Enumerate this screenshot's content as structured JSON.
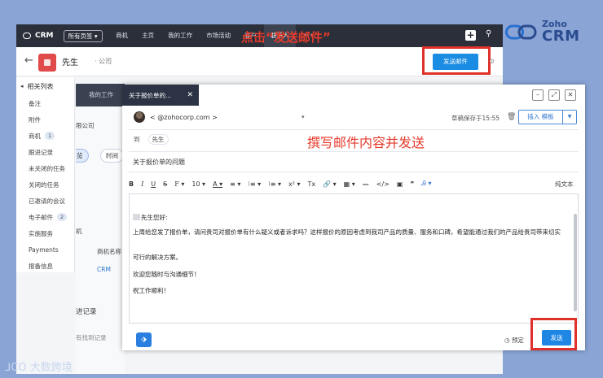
{
  "brand": {
    "word1": "Zoho",
    "word2": "CRM"
  },
  "topbar": {
    "app_name": "CRM",
    "all_pages": "所有页签 ▾",
    "nav": [
      "商机",
      "主页",
      "我的工作",
      "市场活动",
      "客户",
      "联系人",
      "•••"
    ],
    "active_nav": "联系人",
    "plus": "+"
  },
  "header": {
    "back": "←",
    "contact_name": "先生",
    "company": "·                      公司",
    "send_mail_label": "发送邮件"
  },
  "annotations": {
    "click_send": "点击“发送邮件”",
    "compose_hint": "撰写邮件内容并发送"
  },
  "related": {
    "header": "相关列表",
    "items": [
      {
        "label": "备注",
        "badge": ""
      },
      {
        "label": "附件",
        "badge": ""
      },
      {
        "label": "商机",
        "badge": "1"
      },
      {
        "label": "跟进记录",
        "badge": ""
      },
      {
        "label": "未关闭的任务",
        "badge": ""
      },
      {
        "label": "关闭的任务",
        "badge": ""
      },
      {
        "label": "已邀请的会议",
        "badge": ""
      },
      {
        "label": "电子邮件",
        "badge": "2"
      },
      {
        "label": "实施服务",
        "badge": ""
      },
      {
        "label": "Payments",
        "badge": ""
      },
      {
        "label": "报备信息",
        "badge": ""
      }
    ]
  },
  "mid": {
    "tab": "我的工作",
    "company": "限公司",
    "chip1": "览",
    "chip2": "时间",
    "label1": "机",
    "label2": "商机名称",
    "label3": "CRM",
    "label4": "进记录",
    "label5": "有找到记录"
  },
  "dialog": {
    "tab_title": "关于报价单的...",
    "from": "                  <                   @zohocorp.com >",
    "draft_status": "草稿保存于15:55",
    "insert_template": "插入 模板",
    "to_label": "到",
    "to_name": "先生",
    "subject": "关于报价单的问题",
    "toolbar": [
      "B",
      "I",
      "U",
      "S",
      "F ▾",
      "10 ▾",
      "A ▾",
      "≡ ▾",
      "⁝≡ ▾",
      "⁝≡ ▾",
      "x² ▾",
      "Tx",
      "🔗 ▾",
      "▦ ▾",
      "—",
      "</>",
      "▣",
      "❞",
      "Ꭿ ▾"
    ],
    "plain_text": "纯文本",
    "body": [
      "先生您好:",
      "上周给您发了报价单，请问贵司对报价单有什么疑义或者诉求吗？这样报价的原因考虑到我司产品的质量、服务和口碑，希望能通过我们的产品给贵司带来切实",
      "可行的解决方案。",
      "欢迎您随时与沟通细节！",
      "祝工作顺利！"
    ],
    "schedule": "预定",
    "send": "发送"
  },
  "watermark": "大数跨境",
  "colors": {
    "accent": "#1f86e4",
    "annotation": "#e53a2b",
    "highlight_box": "#e0302a"
  }
}
